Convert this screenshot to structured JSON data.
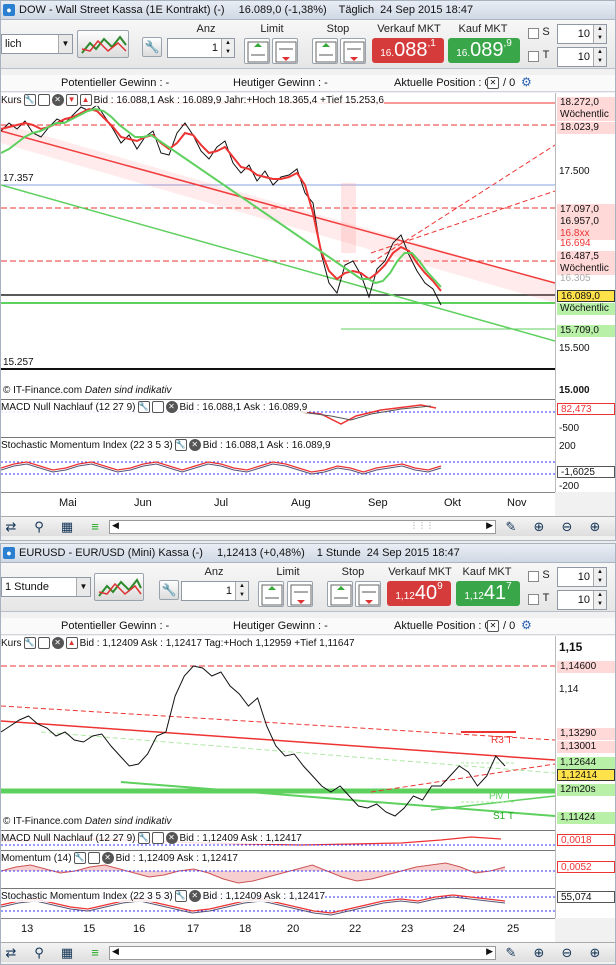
{
  "dow": {
    "title": "DOW - Wall Street Kassa (1E Kontrakt) (-)",
    "price": "16.089,0 (-1,38%)",
    "period": "Täglich",
    "date": "24 Sep 2015 18:47",
    "timeframe": "lich",
    "qty": "1",
    "labels": {
      "anz": "Anz",
      "limit": "Limit",
      "stop": "Stop",
      "sell": "Verkauf MKT",
      "buy": "Kauf MKT"
    },
    "sell_main": "16",
    "sell_sep": ".",
    "sell_big": "088",
    "sell_sub": ",1",
    "buy_main": "16",
    "buy_sep": ".",
    "buy_big": "089",
    "buy_sub": ",9",
    "s_value": "10",
    "t_value": "10",
    "s_label": "S",
    "t_label": "T",
    "info": {
      "potential": "Potentieller Gewinn : -",
      "today": "Heutiger Gewinn : -",
      "position": "Aktuelle Position : 0",
      "pos2": "/ 0"
    },
    "price_header": {
      "name": "Kurs",
      "text": "Bid : 16.088,1 Ask : 16.089,9 Jahr:+Hoch 18.365,4 +Tief 15.253,6"
    },
    "left_labels": {
      "a": "17.357",
      "b": "15.257"
    },
    "watermark": "© IT-Finance.com",
    "watermark2": "Daten sind indikativ",
    "axis": [
      "18.272,0",
      "Wöchentlic",
      "18.023,9",
      "17.500",
      "17.097,0",
      "16.957,0",
      "16.8xx",
      "16.694",
      "16.487,5",
      "Wöchentlic",
      "16.305",
      "16.089,0",
      "Wöchentlic",
      "15.709,0",
      "15.500",
      "15.000"
    ],
    "macd": {
      "name": "MACD Null Nachlauf (12 27 9)",
      "bid": "Bid : 16.088,1 Ask : 16.089,9",
      "v1": "82,473",
      "v2": "-500"
    },
    "stoch": {
      "name": "Stochastic Momentum Index (22 3 5 3)",
      "bid": "Bid : 16.088,1 Ask : 16.089,9",
      "v1": "200",
      "v2": "-1,6025",
      "v3": "-200"
    },
    "months": [
      "Mai",
      "Jun",
      "Jul",
      "Aug",
      "Sep",
      "Okt",
      "Nov"
    ]
  },
  "eur": {
    "title": "EURUSD - EUR/USD (Mini) Kassa (-)",
    "price": "1,12413 (+0,48%)",
    "period": "1 Stunde",
    "date": "24 Sep 2015 18:47",
    "timeframe": "1 Stunde",
    "qty": "1",
    "labels": {
      "anz": "Anz",
      "limit": "Limit",
      "stop": "Stop",
      "sell": "Verkauf MKT",
      "buy": "Kauf MKT"
    },
    "sell_main": "1,12",
    "sell_big": "40",
    "sell_sub": "9",
    "buy_main": "1,12",
    "buy_big": "41",
    "buy_sub": "7",
    "s_value": "10",
    "t_value": "10",
    "s_label": "S",
    "t_label": "T",
    "info": {
      "potential": "Potentieller Gewinn : -",
      "today": "Heutiger Gewinn : -",
      "position": "Aktuelle Position : 0",
      "pos2": "/ 0"
    },
    "price_header": {
      "name": "Kurs",
      "text": "Bid : 1,12409 Ask : 1,12417 Tag:+Hoch 1,12959 +Tief 1,11647"
    },
    "watermark": "© IT-Finance.com",
    "watermark2": "Daten sind indikativ",
    "axis": [
      "1,15",
      "1,14600",
      "1,14",
      "1,13290",
      "1,13001",
      "1,12644",
      "1,12414",
      "12m20s",
      "1,11424"
    ],
    "chart_labels": {
      "r3": "R3 T",
      "piv": "Piv T",
      "s1": "S1 T"
    },
    "macd": {
      "name": "MACD Null Nachlauf (12 27 9)",
      "bid": "Bid : 1,12409 Ask : 1,12417",
      "v1": "0,0018"
    },
    "mom": {
      "name": "Momentum (14)",
      "bid": "Bid : 1,12409 Ask : 1,12417",
      "v1": "0,0052"
    },
    "stoch": {
      "name": "Stochastic Momentum Index (22 3 5 3)",
      "bid": "Bid : 1,12409 Ask : 1,12417",
      "v1": "55,074"
    },
    "days": [
      "13",
      "15",
      "16",
      "17",
      "18",
      "20",
      "22",
      "23",
      "24",
      "25"
    ]
  },
  "colors": {
    "sell": "#d63b3b",
    "buy": "#3aa64a",
    "red_line": "#e53030",
    "green_line": "#5ed05e",
    "tag_red": "#ffd8d8",
    "tag_green": "#b8f0a8",
    "tag_yellow": "#ffe14a"
  }
}
